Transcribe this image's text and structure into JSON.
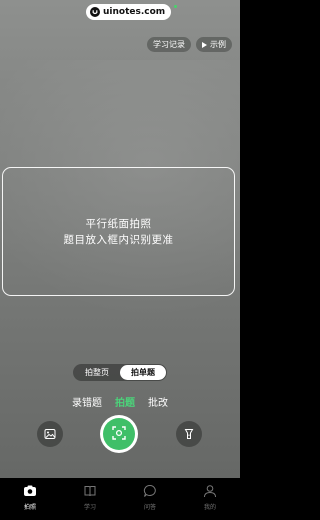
{
  "watermark": {
    "text": "uinotes.com"
  },
  "top_actions": {
    "history_label": "学习记录",
    "example_label": "示例"
  },
  "frame": {
    "line1": "平行纸面拍照",
    "line2": "题目放入框内识别更准"
  },
  "mode_toggle": {
    "options": [
      "拍整页",
      "拍单题"
    ],
    "selected": "拍单题"
  },
  "mode_tabs": {
    "items": [
      "录错题",
      "拍题",
      "批改"
    ],
    "active": "拍题"
  },
  "controls": {
    "left_icon": "image-icon",
    "shutter_icon": "scan-icon",
    "right_icon": "flashlight-icon"
  },
  "tabbar": {
    "items": [
      {
        "label": "拍照",
        "icon": "camera-icon",
        "active": true
      },
      {
        "label": "学习",
        "icon": "book-icon",
        "active": false
      },
      {
        "label": "问答",
        "icon": "chat-icon",
        "active": false
      },
      {
        "label": "我的",
        "icon": "user-icon",
        "active": false
      }
    ]
  },
  "colors": {
    "accent": "#3fbf68",
    "active_tab_text": "#4cd27a"
  }
}
